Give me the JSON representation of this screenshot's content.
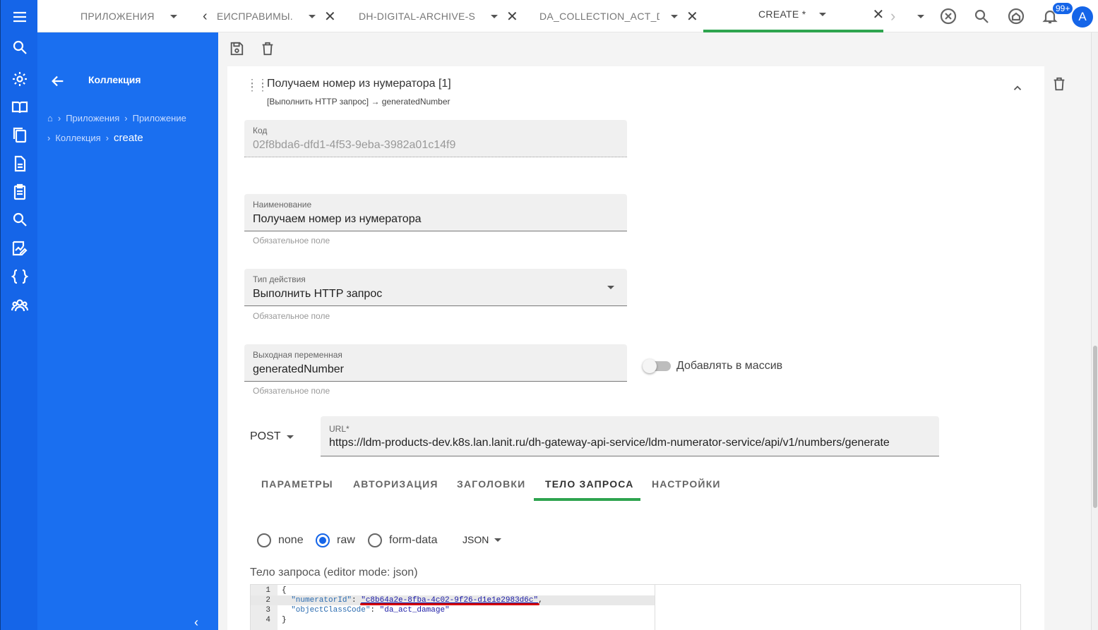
{
  "rail": {
    "icons": [
      "menu-icon",
      "search-icon",
      "gear-icon",
      "book-icon",
      "documents-icon",
      "document-icon",
      "clipboard-icon",
      "search-icon",
      "chart-edit-icon",
      "braces-icon",
      "users-icon"
    ]
  },
  "tabs": [
    {
      "label": "ПРИЛОЖЕНИЯ",
      "closable": false
    },
    {
      "label": "ЕИСПРАВИМЫ...",
      "closable": true
    },
    {
      "label": "DH-DIGITAL-ARCHIVE-S...",
      "closable": true
    },
    {
      "label": "DA_COLLECTION_ACT_D...",
      "closable": true
    },
    {
      "label": "CREATE *",
      "closable": true,
      "active": true
    }
  ],
  "top": {
    "badge": "99+",
    "avatar": "A"
  },
  "panel": {
    "title": "Коллекция",
    "breadcrumbs": [
      "Приложения",
      "Приложение",
      "Коллекция"
    ],
    "current": "create"
  },
  "step": {
    "title": "Получаем номер из нумератора [1]",
    "subtitle_action": "[Выполнить HTTP запрос]",
    "subtitle_arrow": "→",
    "subtitle_var": "generatedNumber"
  },
  "fields": {
    "code": {
      "label": "Код",
      "value": "02f8bda6-dfd1-4f53-9eba-3982a01c14f9"
    },
    "name": {
      "label": "Наименование",
      "value": "Получаем номер из нумератора",
      "hint": "Обязательное поле"
    },
    "action_type": {
      "label": "Тип действия",
      "value": "Выполнить HTTP запрос",
      "hint": "Обязательное поле"
    },
    "output_var": {
      "label": "Выходная переменная",
      "value": "generatedNumber",
      "hint": "Обязательное поле"
    },
    "add_to_array": {
      "label": "Добавлять в массив",
      "checked": false
    }
  },
  "http": {
    "method": "POST",
    "url_label": "URL*",
    "url": "https://ldm-products-dev.k8s.lan.lanit.ru/dh-gateway-api-service/ldm-numerator-service/api/v1/numbers/generate"
  },
  "request_tabs": [
    "ПАРАМЕТРЫ",
    "АВТОРИЗАЦИЯ",
    "ЗАГОЛОВКИ",
    "ТЕЛО ЗАПРОСА",
    "НАСТРОЙКИ"
  ],
  "active_request_tab": "ТЕЛО ЗАПРОСА",
  "body_type": {
    "options": [
      "none",
      "raw",
      "form-data"
    ],
    "selected": "raw",
    "format": "JSON"
  },
  "editor": {
    "label": "Тело запроса (editor mode: json)",
    "lines": [
      {
        "n": "1",
        "text": "{"
      },
      {
        "n": "2",
        "key": "\"numeratorId\"",
        "value": "\"c8b64a2e-8fba-4c02-9f26-d1e1e2983d6c\""
      },
      {
        "n": "3",
        "key": "\"objectClassCode\"",
        "value": "\"da_act_damage\""
      },
      {
        "n": "4",
        "text": "}"
      }
    ]
  },
  "colors": {
    "primary": "#1565e8",
    "panel": "#1a6ff0",
    "accent_green": "#2ea44f",
    "highlight_red": "#d40000"
  }
}
